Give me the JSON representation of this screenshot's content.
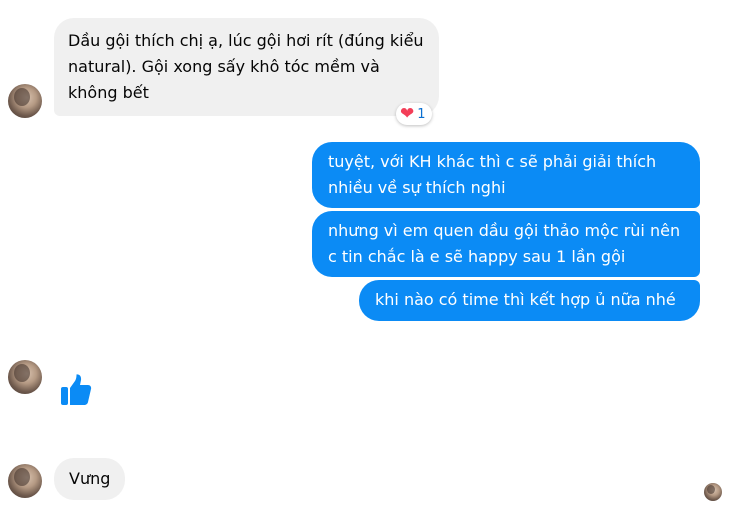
{
  "messages": {
    "m1": "Dầu gội thích chị ạ, lúc gội hơi rít (đúng kiểu natural). Gội xong sấy khô tóc mềm và không bết",
    "m1_reaction": {
      "icon": "heart-icon",
      "count": "1"
    },
    "m2": "tuyệt, với KH khác thì c sẽ phải giải thích nhiều về sự thích nghi",
    "m3": "nhưng vì em quen dầu gội thảo mộc rùi nên c tin chắc là e sẽ happy sau 1 lần gội",
    "m4": "khi nào có time thì kết hợp ủ nữa nhé",
    "m5_icon": "thumbs-up-icon",
    "m6": "Vưng"
  },
  "colors": {
    "incoming_bubble": "#f0f0f0",
    "outgoing_bubble": "#0b8bf5",
    "like_blue": "#0b8bf5",
    "heart_red": "#f33e58"
  }
}
